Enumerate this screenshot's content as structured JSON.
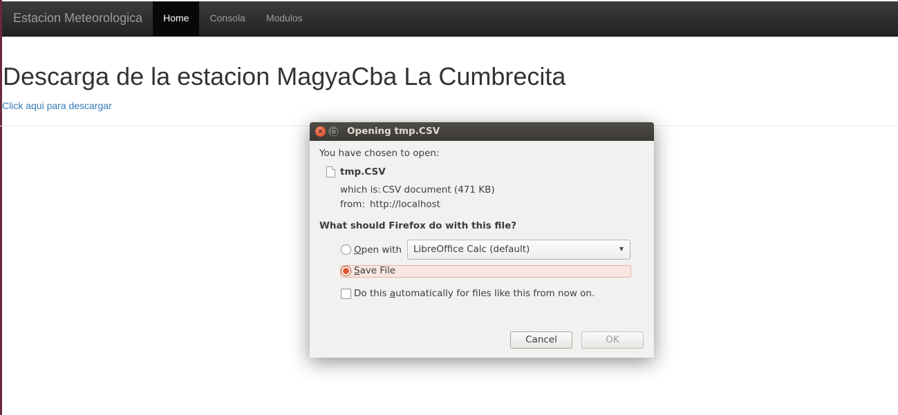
{
  "navbar": {
    "brand": "Estacion Meteorologica",
    "items": [
      {
        "label": "Home",
        "active": true
      },
      {
        "label": "Consola",
        "active": false
      },
      {
        "label": "Modulos",
        "active": false
      }
    ]
  },
  "page": {
    "title": "Descarga de la estacion MagyaCba La Cumbrecita",
    "download_link": "Click aqui para descargar"
  },
  "dialog": {
    "title": "Opening tmp.CSV",
    "chosen_text": "You have chosen to open:",
    "file_name": "tmp.CSV",
    "which_is_label": "which is:",
    "which_is_value": "CSV document (471 KB)",
    "from_label": "from:",
    "from_value": "http://localhost",
    "question": "What should Firefox do with this file?",
    "open_with": {
      "label_accel": "O",
      "label_rest": "pen with",
      "selected": false,
      "app": "LibreOffice Calc (default)"
    },
    "save_file": {
      "label_accel": "S",
      "label_rest": "ave File",
      "selected": true
    },
    "auto": {
      "label_pre": "Do this ",
      "label_accel": "a",
      "label_post": "utomatically for files like this from now on.",
      "checked": false
    },
    "buttons": {
      "cancel": "Cancel",
      "ok": "OK"
    }
  },
  "colors": {
    "navbar_bg": "#222222",
    "link": "#337ab7",
    "titlebar": "#3c3b37",
    "accent": "#e0532b"
  }
}
